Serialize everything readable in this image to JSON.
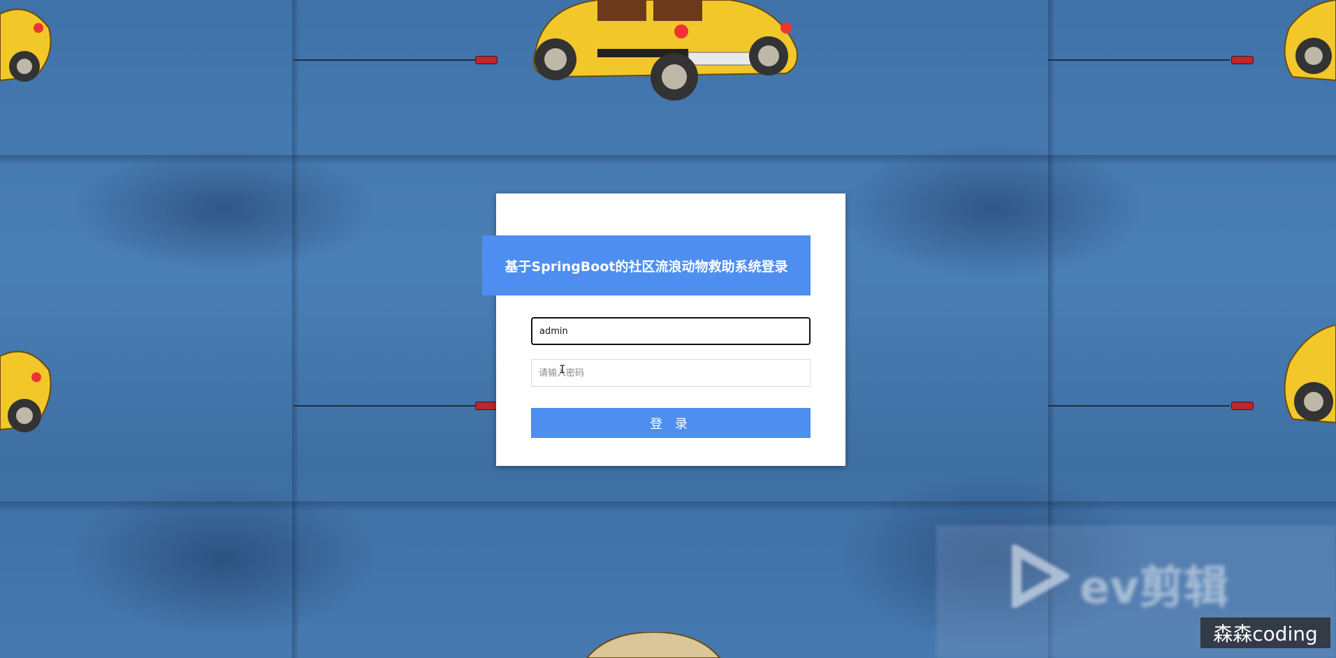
{
  "login": {
    "title": "基于SpringBoot的社区流浪动物救助系统登录",
    "username_value": "admin",
    "password_placeholder": "请输入密码",
    "login_button_label": "登 录"
  },
  "watermark": {
    "logo_text": "ev剪辑",
    "badge_text": "森森coding"
  },
  "colors": {
    "accent": "#4d8ef0",
    "card_background": "#ffffff",
    "page_background": "#4679b0"
  },
  "icons": [
    "ibeam-cursor-icon",
    "ev-logo-icon"
  ]
}
